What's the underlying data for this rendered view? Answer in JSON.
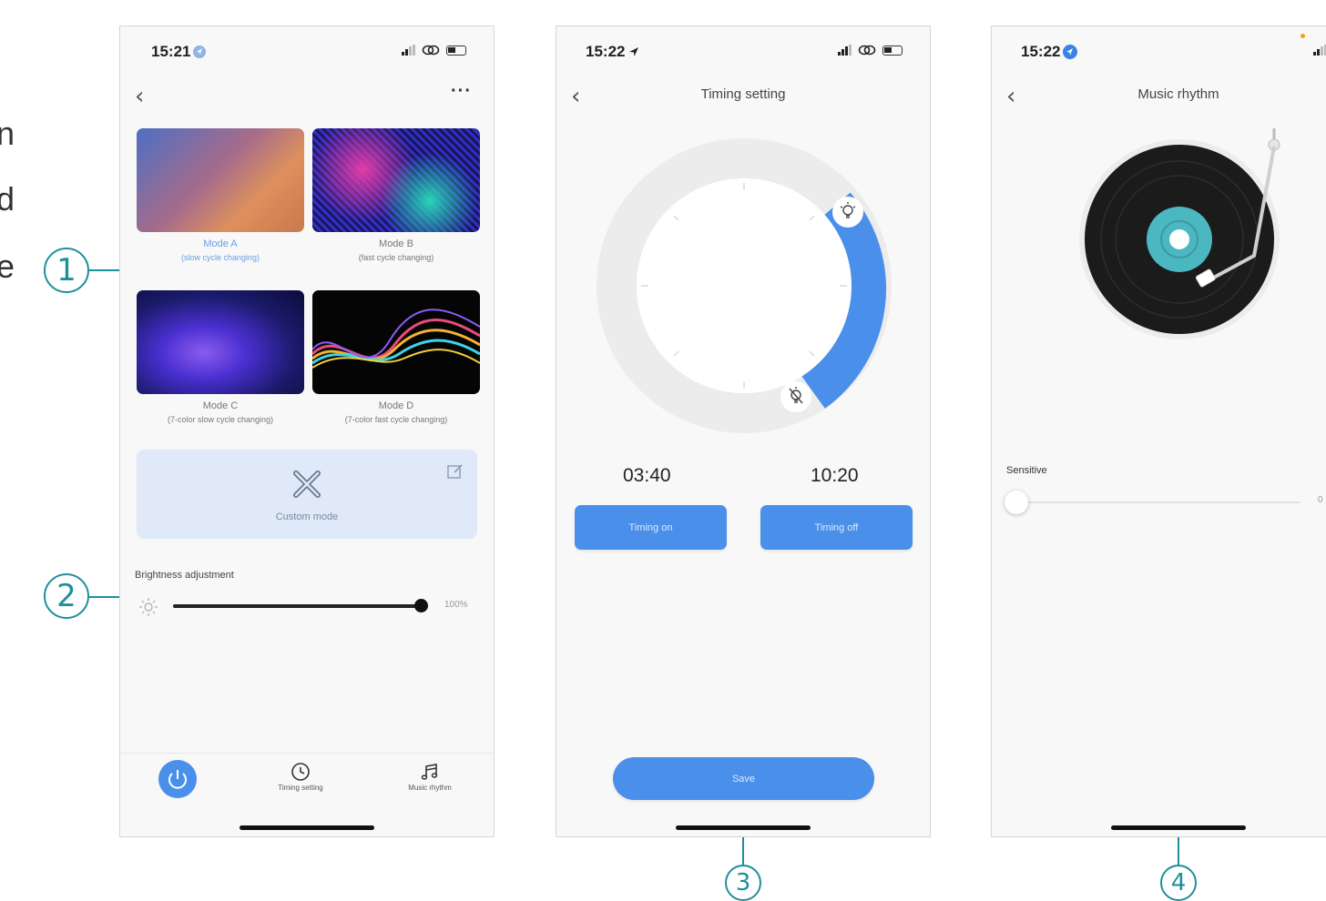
{
  "edge_letters": [
    "n",
    "d",
    "e"
  ],
  "callouts": [
    "1",
    "2",
    "3",
    "4"
  ],
  "colors": {
    "accent_blue": "#4a8fea",
    "callout_teal": "#1f8f9a",
    "ring_gray": "#ececec"
  },
  "screen1": {
    "time": "15:21",
    "modes": [
      {
        "name": "Mode A",
        "desc": "(slow cycle changing)"
      },
      {
        "name": "Mode B",
        "desc": "(fast cycle changing)"
      },
      {
        "name": "Mode C",
        "desc": "(7-color slow cycle changing)"
      },
      {
        "name": "Mode D",
        "desc": "(7-color fast cycle changing)"
      }
    ],
    "custom_mode": "Custom mode",
    "brightness_label": "Brightness adjustment",
    "brightness_value": "100%",
    "brightness_fraction": 1.0,
    "tabs": {
      "timing": "Timing setting",
      "music": "Music rhythm"
    }
  },
  "screen2": {
    "time": "15:22",
    "title": "Timing setting",
    "on_time": "03:40",
    "off_time": "10:20",
    "timing_on_button": "Timing on",
    "timing_off_button": "Timing off",
    "save_button": "Save"
  },
  "screen3": {
    "time": "15:22",
    "title": "Music rhythm",
    "sensitive_label": "Sensitive",
    "sensitive_value": "0",
    "sensitive_fraction": 0.0
  }
}
